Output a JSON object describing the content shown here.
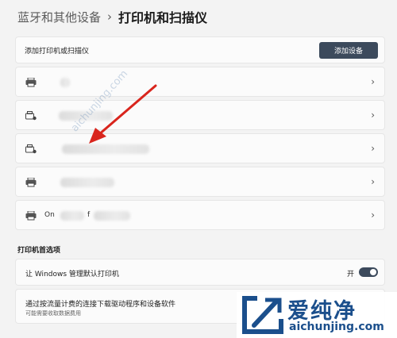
{
  "breadcrumb": {
    "parent": "蓝牙和其他设备",
    "separator": "›",
    "current": "打印机和扫描仪"
  },
  "add_printer": {
    "label": "添加打印机或扫描仪",
    "button": "添加设备"
  },
  "printers": [
    {
      "icon": "printer-icon",
      "name_prefix": "",
      "name_suffix": ""
    },
    {
      "icon": "fax-icon",
      "name_prefix": "",
      "name_suffix": ""
    },
    {
      "icon": "fax-icon",
      "name_prefix": "",
      "name_suffix": ""
    },
    {
      "icon": "printer-icon",
      "name_prefix": "",
      "name_suffix": ""
    },
    {
      "icon": "printer-icon",
      "name_prefix": "On",
      "name_suffix": "f"
    }
  ],
  "preferences": {
    "section_title": "打印机首选项",
    "default_printer_label": "让 Windows 管理默认打印机",
    "default_printer_state": "开",
    "default_printer_on": true,
    "metered_label": "通过按流量计费的连接下载驱动程序和设备软件",
    "metered_sub": "可能需要收取数据费用"
  },
  "watermark": {
    "brand_cn": "爱纯净",
    "url": "aichunjing.com"
  },
  "colors": {
    "accent": "#3c4a5c",
    "arrow": "#d9251d",
    "watermark": "#1b4f8c"
  }
}
